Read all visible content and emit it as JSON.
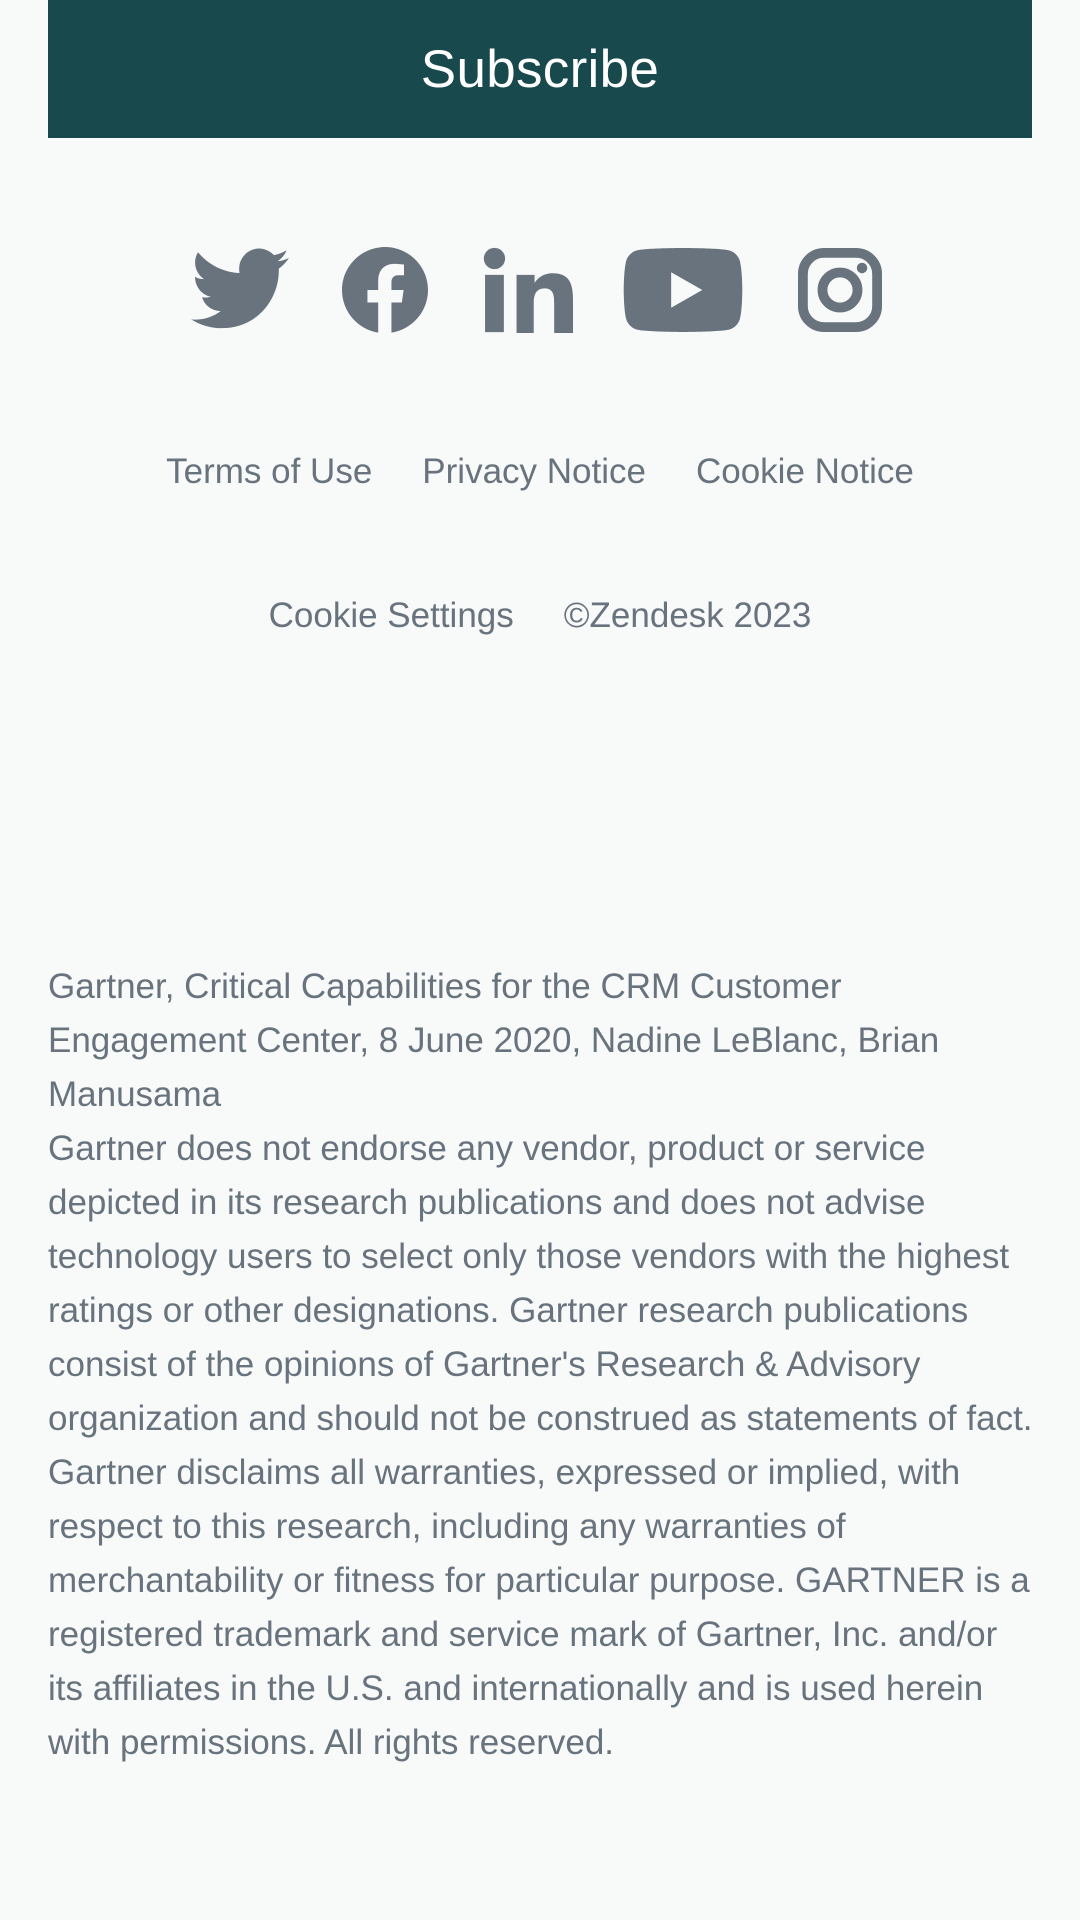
{
  "subscribe": {
    "label": "Subscribe",
    "bg_color": "#17494d"
  },
  "social": [
    {
      "name": "twitter",
      "icon": "twitter-icon"
    },
    {
      "name": "facebook",
      "icon": "facebook-icon"
    },
    {
      "name": "linkedin",
      "icon": "linkedin-icon"
    },
    {
      "name": "youtube",
      "icon": "youtube-icon"
    },
    {
      "name": "instagram",
      "icon": "instagram-icon"
    }
  ],
  "footer_links": {
    "terms": "Terms of Use",
    "privacy": "Privacy Notice",
    "cookie_notice": "Cookie Notice",
    "cookie_settings": "Cookie Settings",
    "copyright": "©Zendesk 2023"
  },
  "disclaimer": {
    "citation": "Gartner, Critical Capabilities for the CRM Customer Engagement Center, 8 June 2020, Nadine LeBlanc, Brian Manusama",
    "body": "Gartner does not endorse any vendor, product or service depicted in its research publications and does not advise technology users to select only those vendors with the highest ratings or other designations. Gartner research publications consist of the opinions of Gartner's Research & Advisory organization and should not be construed as statements of fact. Gartner disclaims all warranties, expressed or implied, with respect to this research, including any warranties of merchantability or fitness for particular purpose. GARTNER is a registered trademark and service mark of Gartner, Inc. and/or its affiliates in the U.S. and internationally and is used herein with permissions. All rights reserved."
  },
  "colors": {
    "text": "#68737d",
    "background": "#f8f9f9",
    "icon": "#68737d"
  }
}
